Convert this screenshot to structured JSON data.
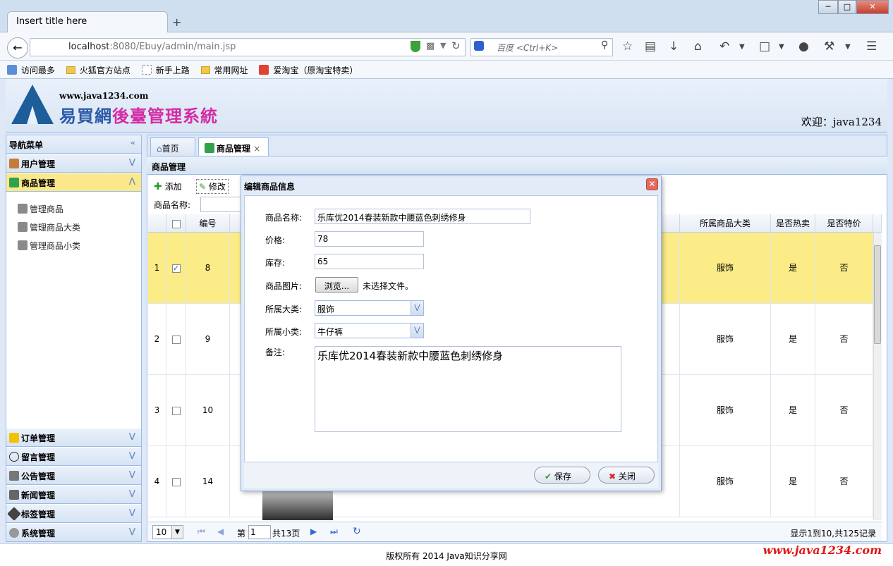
{
  "browser": {
    "tab_title": "Insert title here",
    "new_tab": "+",
    "url_host": "localhost",
    "url_rest": ":8080/Ebuy/admin/main.jsp",
    "search_placeholder": "百度 <Ctrl+K>",
    "window_buttons": [
      "─",
      "□",
      "✕"
    ],
    "bookmarks": [
      "访问最多",
      "火狐官方站点",
      "新手上路",
      "常用网址",
      "爱淘宝（原淘宝特卖）"
    ]
  },
  "header": {
    "site_url": "www.java1234.com",
    "title_part1": "易買網",
    "title_part2": "後臺管理系統",
    "welcome": "欢迎：java1234"
  },
  "nav": {
    "title": "导航菜单",
    "top_sections": [
      {
        "label": "用户管理"
      },
      {
        "label": "商品管理"
      }
    ],
    "items": [
      "管理商品",
      "管理商品大类",
      "管理商品小类"
    ],
    "bottom_sections": [
      {
        "label": "订单管理"
      },
      {
        "label": "留言管理"
      },
      {
        "label": "公告管理"
      },
      {
        "label": "新闻管理"
      },
      {
        "label": "标签管理"
      },
      {
        "label": "系统管理"
      }
    ]
  },
  "tabs": [
    {
      "label": "首页"
    },
    {
      "label": "商品管理",
      "close": "×"
    }
  ],
  "panel": {
    "title": "商品管理",
    "toolbar": {
      "add": "添加",
      "edit": "修改"
    },
    "search_label": "商品名称:"
  },
  "grid": {
    "headers": {
      "id": "编号",
      "bigtype": "所属商品大类",
      "hot": "是否热卖",
      "special": "是否特价"
    },
    "rows": [
      {
        "rownum": "1",
        "id": "8",
        "bigtype": "服饰",
        "hot": "是",
        "special": "否",
        "checked": true
      },
      {
        "rownum": "2",
        "id": "9",
        "bigtype": "服饰",
        "hot": "是",
        "special": "否"
      },
      {
        "rownum": "3",
        "id": "10",
        "bigtype": "服饰",
        "hot": "是",
        "special": "否"
      },
      {
        "rownum": "4",
        "id": "14",
        "bigtype": "服饰",
        "hot": "是",
        "special": "否"
      }
    ]
  },
  "pager": {
    "page_size": "10",
    "page_prefix": "第",
    "page_value": "1",
    "page_suffix": "共13页",
    "summary": "显示1到10,共125记录"
  },
  "footer": {
    "copyright": "版权所有 2014 Java知识分享网",
    "watermark": "www.java1234.com"
  },
  "dialog": {
    "title": "编辑商品信息",
    "fields": {
      "name_label": "商品名称:",
      "name_value": "乐库优2014春装新款中腰蓝色刺绣修身",
      "price_label": "价格:",
      "price_value": "78",
      "stock_label": "库存:",
      "stock_value": "65",
      "image_label": "商品图片:",
      "browse": "浏览...",
      "no_file": "未选择文件。",
      "bigtype_label": "所属大类:",
      "bigtype_value": "服饰",
      "smalltype_label": "所属小类:",
      "smalltype_value": "牛仔裤",
      "remark_label": "备注:",
      "remark_value": "乐库优2014春装新款中腰蓝色刺绣修身"
    },
    "save": "保存",
    "close": "关闭"
  }
}
